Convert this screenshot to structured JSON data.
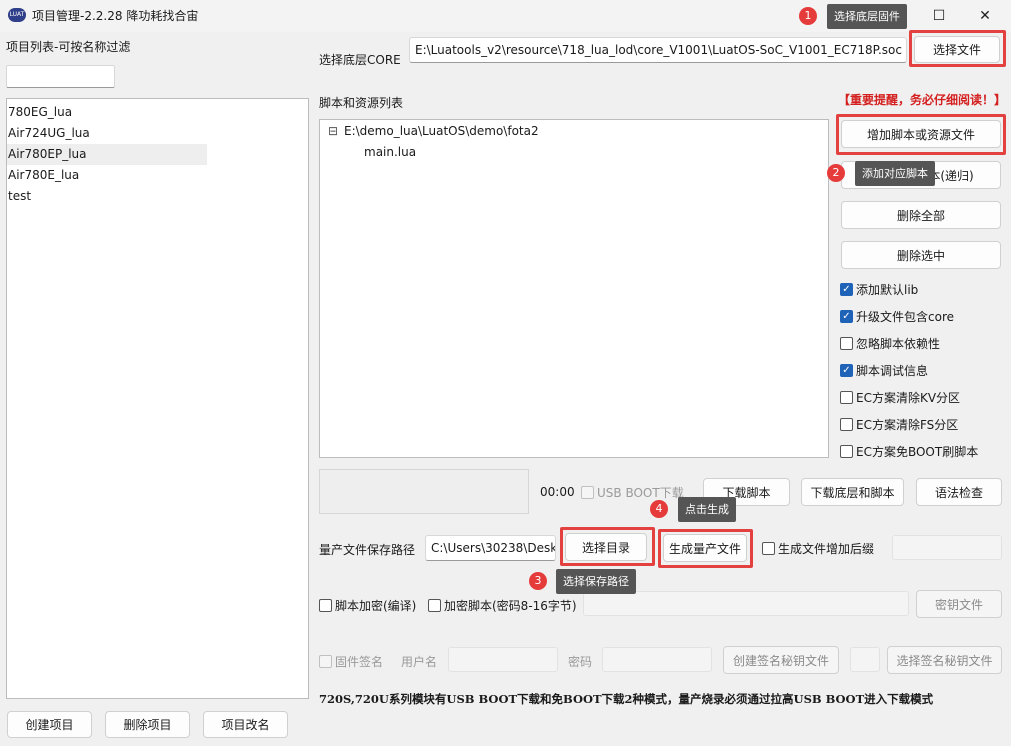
{
  "window": {
    "icon_text": "LUAT",
    "title": "项目管理-2.2.28 降功耗找合宙",
    "minimize": "—",
    "maximize": "☐",
    "close": "✕"
  },
  "left": {
    "filter_label": "项目列表-可按名称过滤",
    "filter_value": "",
    "projects": [
      "780EG_lua",
      "Air724UG_lua",
      "Air780EP_lua",
      "Air780E_lua",
      "test"
    ],
    "create_btn": "创建项目",
    "delete_btn": "删除项目",
    "rename_btn": "项目改名"
  },
  "core": {
    "label": "选择底层CORE",
    "path": "E:\\Luatools_v2\\resource\\718_lua_lod\\core_V1001\\LuatOS-SoC_V1001_EC718P.soc",
    "select_btn": "选择文件"
  },
  "scripts": {
    "label": "脚本和资源列表",
    "tree_root": "E:\\demo_lua\\LuatOS\\demo\\fota2",
    "tree_child": "main.lua",
    "expander": "⊟"
  },
  "right": {
    "notice": "【重要提醒，务必仔细阅读！】",
    "add_btn": "增加脚本或资源文件",
    "add_recursive_btn": "添加对应脚本(递归)",
    "delete_all_btn": "删除全部",
    "delete_selected_btn": "删除选中",
    "options": [
      {
        "label": "添加默认lib",
        "checked": true
      },
      {
        "label": "升级文件包含core",
        "checked": true
      },
      {
        "label": "忽略脚本依赖性",
        "checked": false
      },
      {
        "label": "脚本调试信息",
        "checked": true
      },
      {
        "label": "EC方案清除KV分区",
        "checked": false
      },
      {
        "label": "EC方案清除FS分区",
        "checked": false
      },
      {
        "label": "EC方案免BOOT刷脚本",
        "checked": false
      }
    ]
  },
  "download": {
    "timer": "00:00",
    "usb_boot_label": "USB BOOT下载",
    "download_script_btn": "下载脚本",
    "download_core_script_btn": "下载底层和脚本",
    "syntax_check_btn": "语法检查"
  },
  "mass": {
    "path_label": "量产文件保存路径",
    "path_value": "C:\\Users\\30238\\Desk",
    "select_dir_btn": "选择目录",
    "generate_btn": "生成量产文件",
    "suffix_label": "生成文件增加后缀",
    "suffix_value": ""
  },
  "encrypt": {
    "script_encrypt_label": "脚本加密(编译)",
    "encrypt_script_label": "加密脚本(密码8-16字节)",
    "password_value": "",
    "key_file_btn": "密钥文件"
  },
  "sign": {
    "firmware_sign_label": "固件签名",
    "username_label": "用户名",
    "password_label": "密码",
    "create_key_btn": "创建签名秘钥文件",
    "select_key_btn": "选择签名秘钥文件"
  },
  "footer_note": "720S,720U系列模块有USB BOOT下载和免BOOT下载2种模式，量产烧录必须通过拉高USB BOOT进入下载模式",
  "annotations": [
    {
      "num": "1",
      "text": "选择底层固件"
    },
    {
      "num": "2",
      "text": "添加对应脚本"
    },
    {
      "num": "3",
      "text": "选择保存路径"
    },
    {
      "num": "4",
      "text": "点击生成"
    }
  ],
  "colors": {
    "highlight": "#e34040",
    "checkbox_on": "#1e63b8",
    "tooltip_bg": "#555555",
    "notice_red": "#d42020"
  },
  "checkmark": "✓"
}
